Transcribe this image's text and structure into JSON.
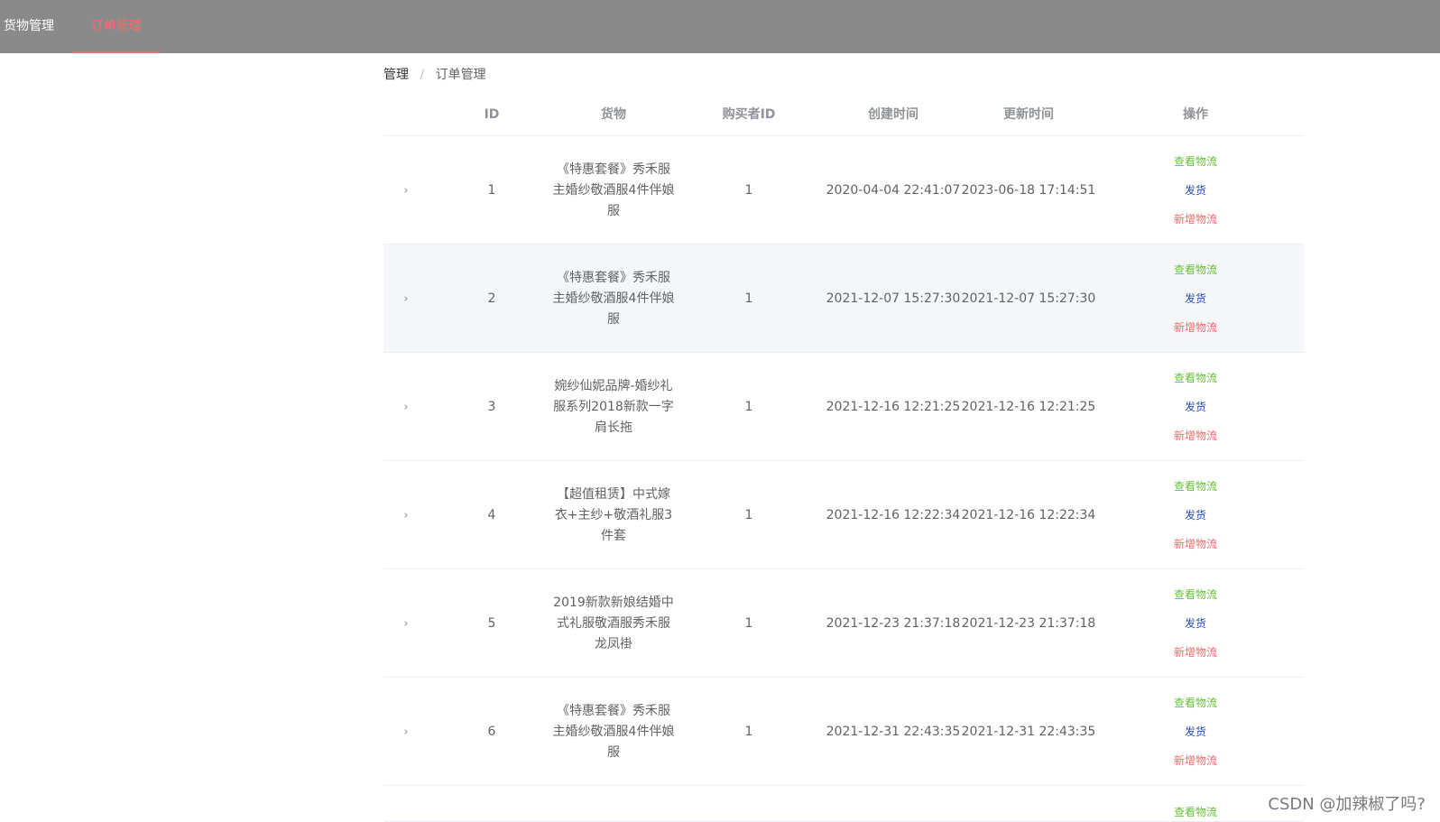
{
  "nav": {
    "items": [
      {
        "label": "货物管理",
        "active": false
      },
      {
        "label": "订单管理",
        "active": true
      }
    ],
    "active_color": "#f56c6c",
    "bar_color": "#8a8a8a"
  },
  "breadcrumb": {
    "root": "管理",
    "separator": "/",
    "current": "订单管理"
  },
  "table": {
    "headers": {
      "id": "ID",
      "goods": "货物",
      "buyer_id": "购买者ID",
      "created": "创建时间",
      "updated": "更新时间",
      "actions": "操作"
    },
    "action_labels": {
      "view_logistics": "查看物流",
      "ship": "发货",
      "add_logistics": "新增物流"
    },
    "rows": [
      {
        "id": "1",
        "goods": "《特惠套餐》秀禾服主婚纱敬酒服4件伴娘服",
        "buyer_id": "1",
        "created": "2020-04-04 22:41:07",
        "updated": "2023-06-18 17:14:51"
      },
      {
        "id": "2",
        "goods": "《特惠套餐》秀禾服主婚纱敬酒服4件伴娘服",
        "buyer_id": "1",
        "created": "2021-12-07 15:27:30",
        "updated": "2021-12-07 15:27:30"
      },
      {
        "id": "3",
        "goods": "婉纱仙妮品牌-婚纱礼服系列2018新款一字肩长拖",
        "buyer_id": "1",
        "created": "2021-12-16 12:21:25",
        "updated": "2021-12-16 12:21:25"
      },
      {
        "id": "4",
        "goods": "【超值租赁】中式嫁衣+主纱+敬酒礼服3件套",
        "buyer_id": "1",
        "created": "2021-12-16 12:22:34",
        "updated": "2021-12-16 12:22:34"
      },
      {
        "id": "5",
        "goods": "2019新款新娘结婚中式礼服敬酒服秀禾服龙凤褂",
        "buyer_id": "1",
        "created": "2021-12-23 21:37:18",
        "updated": "2021-12-23 21:37:18"
      },
      {
        "id": "6",
        "goods": "《特惠套餐》秀禾服主婚纱敬酒服4件伴娘服",
        "buyer_id": "1",
        "created": "2021-12-31 22:43:35",
        "updated": "2021-12-31 22:43:35"
      }
    ],
    "partial_next_row_action": "查看物流"
  },
  "watermark": "CSDN @加辣椒了吗?"
}
